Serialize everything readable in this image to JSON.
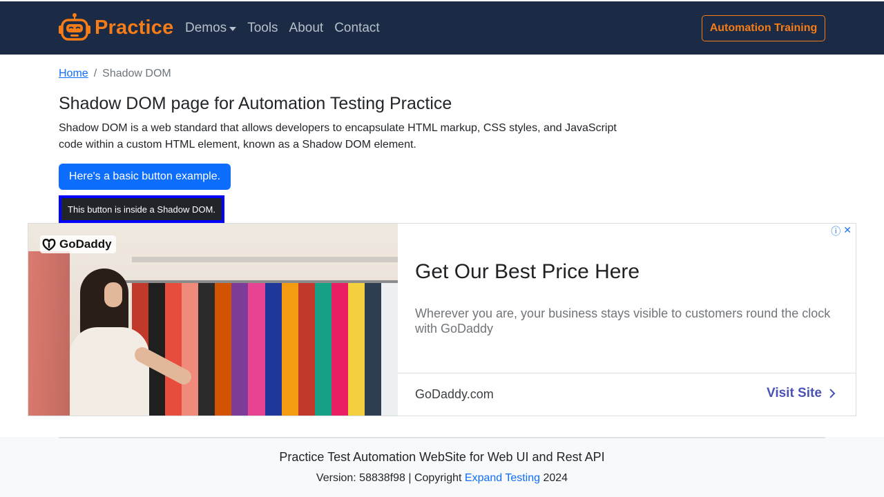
{
  "navbar": {
    "brand": "Practice",
    "links": [
      {
        "label": "Demos",
        "has_dropdown": true
      },
      {
        "label": "Tools"
      },
      {
        "label": "About"
      },
      {
        "label": "Contact"
      }
    ],
    "cta_label": "Automation Training",
    "colors": {
      "background": "#1b2b45",
      "accent": "#f57c17",
      "link": "#b7bfcb"
    }
  },
  "breadcrumb": {
    "home": "Home",
    "separator": "/",
    "current": "Shadow DOM"
  },
  "main": {
    "title": "Shadow DOM page for Automation Testing Practice",
    "description": "Shadow DOM is a web standard that allows developers to encapsulate HTML markup, CSS styles, and JavaScript code within a custom HTML element, known as a Shadow DOM element.",
    "basic_button_label": "Here's a basic button example.",
    "shadow_button_label": "This button is inside a Shadow DOM."
  },
  "ad": {
    "advertiser_logo": "GoDaddy",
    "info_icon": "info-icon",
    "close_icon": "close-icon",
    "headline": "Get Our Best Price Here",
    "description": "Wherever you are, your business stays visible to customers round the clock with GoDaddy",
    "domain": "GoDaddy.com",
    "cta_label": "Visit Site",
    "colors": {
      "cta": "#4a52b8"
    }
  },
  "footer": {
    "title": "Practice Test Automation WebSite for Web UI and Rest API",
    "version_text": "Version: 58838f98 | Copyright",
    "link_label": "Expand Testing",
    "year": "2024"
  }
}
